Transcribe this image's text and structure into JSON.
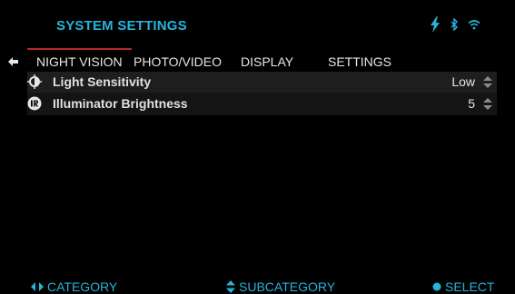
{
  "header": {
    "title": "SYSTEM SETTINGS",
    "icons": [
      "lightning-icon",
      "bluetooth-icon",
      "wifi-icon"
    ]
  },
  "tabs": [
    {
      "label": "NIGHT VISION",
      "active": true
    },
    {
      "label": "PHOTO/VIDEO",
      "active": false
    },
    {
      "label": "DISPLAY",
      "active": false
    },
    {
      "label": "SETTINGS",
      "active": false
    }
  ],
  "settings": [
    {
      "label": "Light Sensitivity",
      "value": "Low",
      "icon": "contrast-icon"
    },
    {
      "label": "Illuminator Brightness",
      "value": "5",
      "icon": "ir-icon"
    }
  ],
  "footer": {
    "category": "CATEGORY",
    "subcategory": "SUBCATEGORY",
    "select": "SELECT"
  },
  "colors": {
    "accent": "#27b4dc",
    "active_tab_underline": "#b22a2a",
    "background": "#000000"
  }
}
